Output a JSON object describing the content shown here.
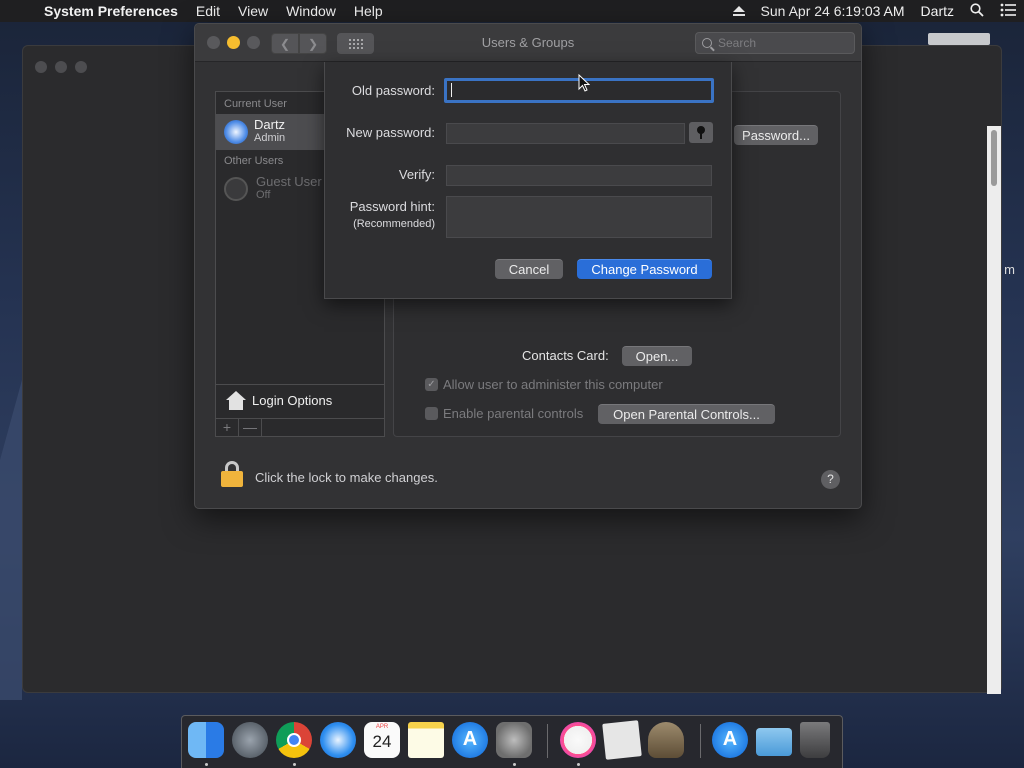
{
  "menubar": {
    "app_name": "System Preferences",
    "menus": [
      "Edit",
      "View",
      "Window",
      "Help"
    ],
    "date_time": "Sun Apr 24  6:19:03 AM",
    "user": "Dartz"
  },
  "window": {
    "title": "Users & Groups",
    "search_placeholder": "Search"
  },
  "users": {
    "current_section": "Current User",
    "current_user": {
      "name": "Dartz",
      "role": "Admin"
    },
    "other_section": "Other Users",
    "guest": {
      "name": "Guest User",
      "status": "Off"
    },
    "login_options": "Login Options",
    "add_label": "+",
    "remove_label": "—"
  },
  "panel": {
    "password_button": "Password...",
    "contacts_label": "Contacts Card:",
    "open_button": "Open...",
    "allow_admin_label": "Allow user to administer this computer",
    "allow_admin_checked": true,
    "parental_label": "Enable parental controls",
    "parental_checked": false,
    "parental_button": "Open Parental Controls..."
  },
  "lock": {
    "text": "Click the lock to make changes.",
    "help": "?"
  },
  "sheet": {
    "old_label": "Old password:",
    "old_value": "",
    "new_label": "New password:",
    "new_value": "",
    "verify_label": "Verify:",
    "verify_value": "",
    "hint_label": "Password hint:",
    "hint_sublabel": "(Recommended)",
    "hint_value": "",
    "cancel": "Cancel",
    "change": "Change Password"
  },
  "background_window": {
    "partial_text": "m"
  },
  "dock": {
    "apps": [
      "finder-icon",
      "launchpad-icon",
      "chrome-icon",
      "safari-icon",
      "calendar-icon",
      "notes-icon",
      "app-store-icon",
      "system-preferences-icon",
      "itunes-icon",
      "preview-icon",
      "chess-icon",
      "app-store-folder-icon",
      "downloads-folder-icon",
      "trash-icon"
    ],
    "calendar_month": "APR",
    "calendar_day": "24"
  },
  "colors": {
    "accent": "#2a6ed8",
    "focus_ring": "#3a73c4",
    "minimize": "#f6bd2f",
    "lock": "#f0b43c"
  }
}
